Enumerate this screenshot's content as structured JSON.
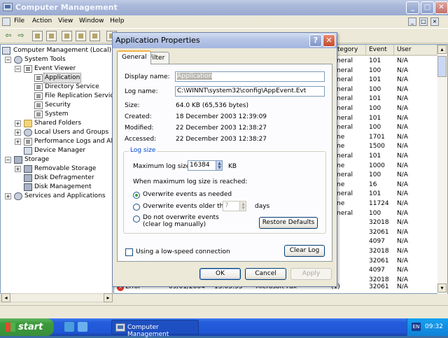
{
  "main_window": {
    "title": "Computer Management",
    "menu": [
      "File",
      "Action",
      "View",
      "Window",
      "Help"
    ],
    "tree": {
      "root": "Computer Management (Local)",
      "system_tools": "System Tools",
      "event_viewer": "Event Viewer",
      "logs": [
        "Application",
        "Directory Service",
        "File Replication Service",
        "Security",
        "System"
      ],
      "shared_folders": "Shared Folders",
      "local_users": "Local Users and Groups",
      "perf_logs": "Performance Logs and Alerts",
      "device_manager": "Device Manager",
      "storage": "Storage",
      "removable_storage": "Removable Storage",
      "disk_defrag": "Disk Defragmenter",
      "disk_management": "Disk Management",
      "services": "Services and Applications"
    },
    "list": {
      "columns": [
        "tegory",
        "Event",
        "User"
      ],
      "rows": [
        {
          "category": "neral",
          "event": "101",
          "user": "N/A"
        },
        {
          "category": "neral",
          "event": "100",
          "user": "N/A"
        },
        {
          "category": "neral",
          "event": "101",
          "user": "N/A"
        },
        {
          "category": "neral",
          "event": "100",
          "user": "N/A"
        },
        {
          "category": "neral",
          "event": "101",
          "user": "N/A"
        },
        {
          "category": "neral",
          "event": "100",
          "user": "N/A"
        },
        {
          "category": "neral",
          "event": "101",
          "user": "N/A"
        },
        {
          "category": "neral",
          "event": "100",
          "user": "N/A"
        },
        {
          "category": "ne",
          "event": "1701",
          "user": "N/A"
        },
        {
          "category": "ne",
          "event": "1500",
          "user": "N/A"
        },
        {
          "category": "neral",
          "event": "101",
          "user": "N/A"
        },
        {
          "category": "ne",
          "event": "1000",
          "user": "N/A"
        },
        {
          "category": "neral",
          "event": "100",
          "user": "N/A"
        },
        {
          "category": "ne",
          "event": "16",
          "user": "N/A"
        },
        {
          "category": "neral",
          "event": "101",
          "user": "N/A"
        },
        {
          "category": "ne",
          "event": "11724",
          "user": "N/A"
        },
        {
          "category": "neral",
          "event": "100",
          "user": "N/A"
        },
        {
          "category": "",
          "event": "32018",
          "user": "N/A"
        },
        {
          "category": "",
          "event": "32061",
          "user": "N/A"
        },
        {
          "category": "",
          "event": "4097",
          "user": "N/A"
        },
        {
          "category": "",
          "event": "32018",
          "user": "N/A"
        },
        {
          "category": "",
          "event": "32061",
          "user": "N/A"
        },
        {
          "category": "",
          "event": "4097",
          "user": "N/A"
        },
        {
          "category": "",
          "event": "32018",
          "user": "N/A"
        }
      ],
      "bottom_row": {
        "type": "Error",
        "date": "09/01/2004",
        "time": "13:05:53",
        "source": "Microsoft Fax",
        "category": "(1)",
        "event": "32061",
        "user": "N/A"
      }
    }
  },
  "dialog": {
    "title": "Application Properties",
    "tabs": [
      "General",
      "Filter"
    ],
    "display_name_label": "Display name:",
    "display_name_value": "Application",
    "log_name_label": "Log name:",
    "log_name_value": "C:\\WINNT\\system32\\config\\AppEvent.Evt",
    "size_label": "Size:",
    "size_value": "64.0 KB (65,536 bytes)",
    "created_label": "Created:",
    "created_value": "18 December 2003 12:39:09",
    "modified_label": "Modified:",
    "modified_value": "22 December 2003 12:38:27",
    "accessed_label": "Accessed:",
    "accessed_value": "22 December 2003 12:38:27",
    "log_size_group": "Log size",
    "max_size_label": "Maximum log size:",
    "max_size_value": "16384",
    "max_size_unit": "KB",
    "when_reached_label": "When maximum log size is reached:",
    "opt_overwrite_needed": "Overwrite events as needed",
    "opt_overwrite_older": "Overwrite events older than",
    "older_than_value": "7",
    "days_label": "days",
    "opt_no_overwrite_1": "Do not overwrite events",
    "opt_no_overwrite_2": "(clear log manually)",
    "restore_defaults": "Restore Defaults",
    "low_speed_label": "Using a low-speed connection",
    "clear_log": "Clear Log",
    "ok": "OK",
    "cancel": "Cancel",
    "apply": "Apply"
  },
  "taskbar": {
    "start": "start",
    "task_label": "Computer Management",
    "lang": "EN",
    "clock": "09:32"
  }
}
